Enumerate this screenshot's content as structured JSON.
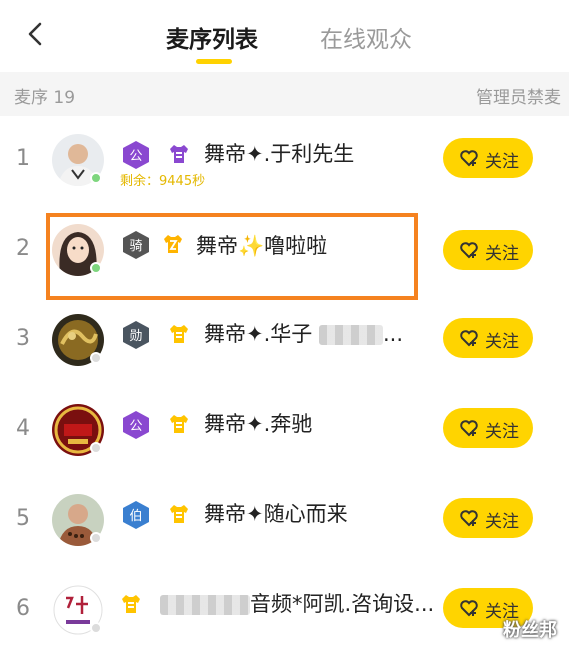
{
  "header": {
    "tabs": [
      {
        "label": "麦序列表",
        "active": true
      },
      {
        "label": "在线观众",
        "active": false
      }
    ],
    "accent_color": "#ffd200"
  },
  "subheader": {
    "label": "麦序 19",
    "right": "管理员禁麦"
  },
  "rows": [
    {
      "index": "1",
      "badge": "公",
      "badge_color": "#8a48d0",
      "shirt_color": "#8a48d0",
      "name": "舞帝✦.于利先生",
      "sub": "剩余：9445秒",
      "follow": "关注",
      "online": true
    },
    {
      "index": "2",
      "badge": "骑",
      "badge_color": "#555555",
      "shirt_color": "#ffb400",
      "name": "舞帝✨噜啦啦",
      "follow": "关注",
      "online": true,
      "highlighted": true
    },
    {
      "index": "3",
      "badge": "勋",
      "badge_color": "#4a5560",
      "shirt_color": "#ffc400",
      "name": "舞帝✦.华子",
      "name_suffix": "...",
      "follow": "关注",
      "online": false
    },
    {
      "index": "4",
      "badge": "公",
      "badge_color": "#8a48d0",
      "shirt_color": "#ffc400",
      "name": "舞帝✦.奔驰",
      "follow": "关注",
      "online": false
    },
    {
      "index": "5",
      "badge": "伯",
      "badge_color": "#3a7fd0",
      "shirt_color": "#ffc400",
      "name": "舞帝✦随心而来",
      "follow": "关注",
      "online": false
    },
    {
      "index": "6",
      "shirt_color": "#ffc400",
      "name": "音频*阿凯.咨询设...",
      "follow": "关注",
      "online": false
    }
  ],
  "watermark": "粉丝邦",
  "colors": {
    "follow_button": "#ffd400",
    "highlight_border": "#f58220",
    "online_dot": "#7ed67e",
    "offline_dot": "#dcdcdc"
  }
}
